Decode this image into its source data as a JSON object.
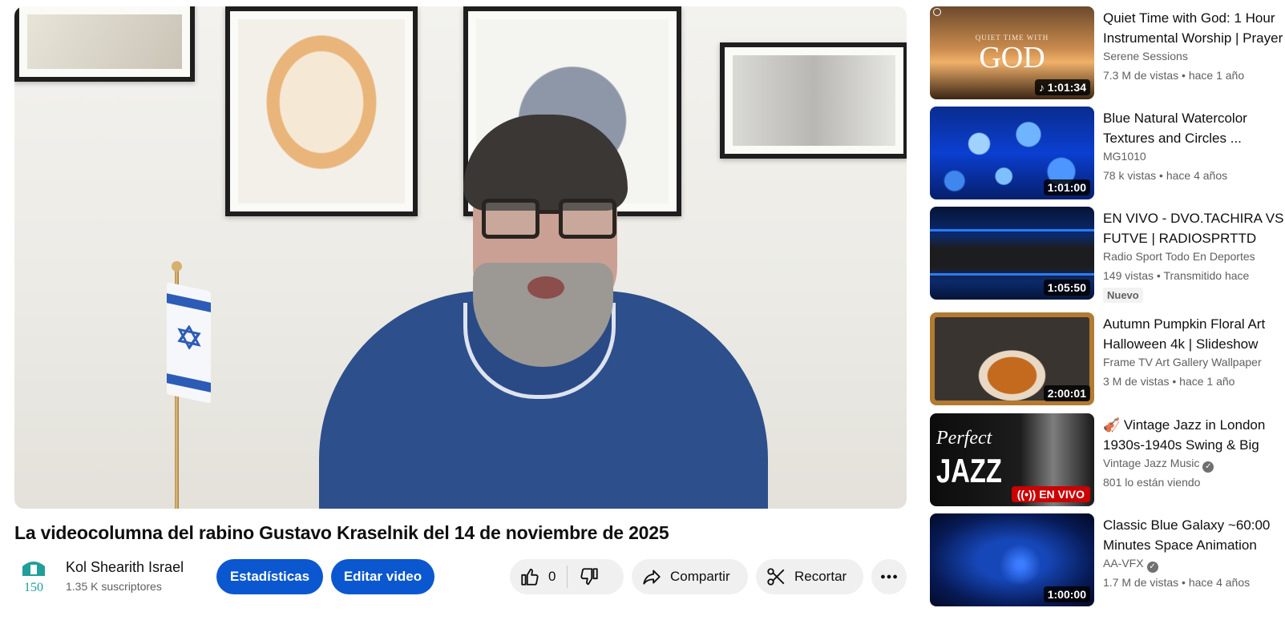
{
  "video": {
    "title": "La videocolumna del rabino Gustavo Kraselnik del 14 de noviembre de 2025"
  },
  "channel": {
    "name": "Kol Shearith Israel",
    "subscribers": "1.35 K suscriptores",
    "avatar_text": "150"
  },
  "actions": {
    "stats_label": "Estadísticas",
    "edit_label": "Editar video",
    "like_count": "0",
    "share_label": "Compartir",
    "clip_label": "Recortar"
  },
  "recommendations": [
    {
      "title_line1": "Quiet Time with God: 1 Hour",
      "title_line2": "Instrumental Worship | Prayer",
      "channel": "Serene Sessions",
      "meta": "7.3 M de vistas • hace 1 año",
      "duration": "1:01:34",
      "thumb_text_small": "QUIET TIME WITH",
      "thumb_text_big": "GOD"
    },
    {
      "title_line1": "Blue Natural Watercolor",
      "title_line2": "Textures and Circles ...",
      "channel": "MG1010",
      "meta": "78 k vistas • hace 4 años",
      "duration": "1:01:00"
    },
    {
      "title_line1": "EN VIVO - DVO.TACHIRA VS",
      "title_line2": "FUTVE | RADIOSPRTTD",
      "channel": "Radio Sport Todo En Deportes",
      "meta": "149 vistas • Transmitido hace",
      "duration": "1:05:50",
      "badge": "Nuevo"
    },
    {
      "title_line1": "Autumn Pumpkin Floral Art",
      "title_line2": "Halloween 4k | Slideshow",
      "channel": "Frame TV Art Gallery Wallpaper",
      "meta": "3 M de vistas • hace 1 año",
      "duration": "2:00:01"
    },
    {
      "title_line1": "🎻 Vintage Jazz in London",
      "title_line2": "1930s-1940s Swing & Big",
      "channel": "Vintage Jazz Music",
      "meta": "801 lo están viendo",
      "live": "EN VIVO",
      "thumb_text_small": "Perfect",
      "thumb_text_big": "JAZZ"
    },
    {
      "title_line1": "Classic Blue Galaxy ~60:00",
      "title_line2": "Minutes Space Animation",
      "channel": "AA-VFX",
      "meta": "1.7 M de vistas • hace 4 años",
      "duration": "1:00:00"
    }
  ]
}
